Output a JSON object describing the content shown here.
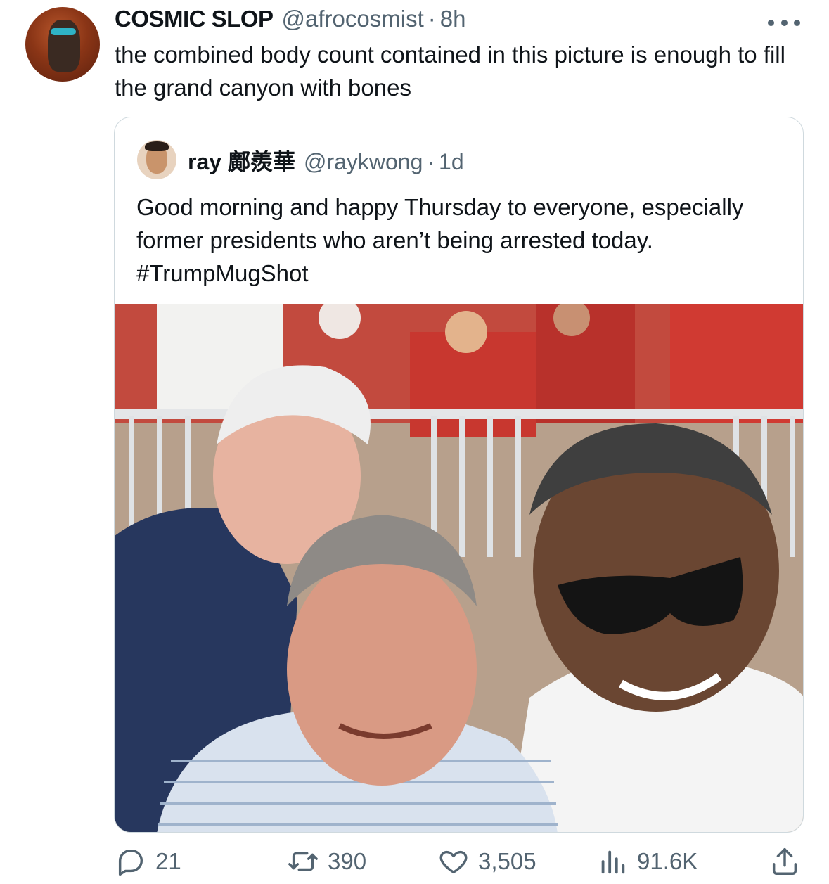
{
  "author": {
    "display_name": "COSMIC SLOP",
    "handle": "@afrocosmist",
    "separator": "·",
    "time": "8h",
    "avatar_icon": "profile-avatar"
  },
  "tweet": {
    "text": "the combined body count contained in this picture is enough to fill the grand canyon with bones"
  },
  "more_icon": "more-options-icon",
  "quoted": {
    "display_name": "ray 鄺羨華",
    "handle": "@raykwong",
    "separator": "·",
    "time": "1d",
    "text": "Good morning and happy Thursday to everyone, especially former presidents who aren’t being arrested today. #TrumpMugShot",
    "photo_alt": "Three men taking a selfie in front of a crowd at a sports event"
  },
  "actions": {
    "replies": "21",
    "retweets": "390",
    "likes": "3,505",
    "views": "91.6K"
  },
  "colors": {
    "text": "#0f1419",
    "secondary": "#536471",
    "border": "#cfd9de"
  }
}
